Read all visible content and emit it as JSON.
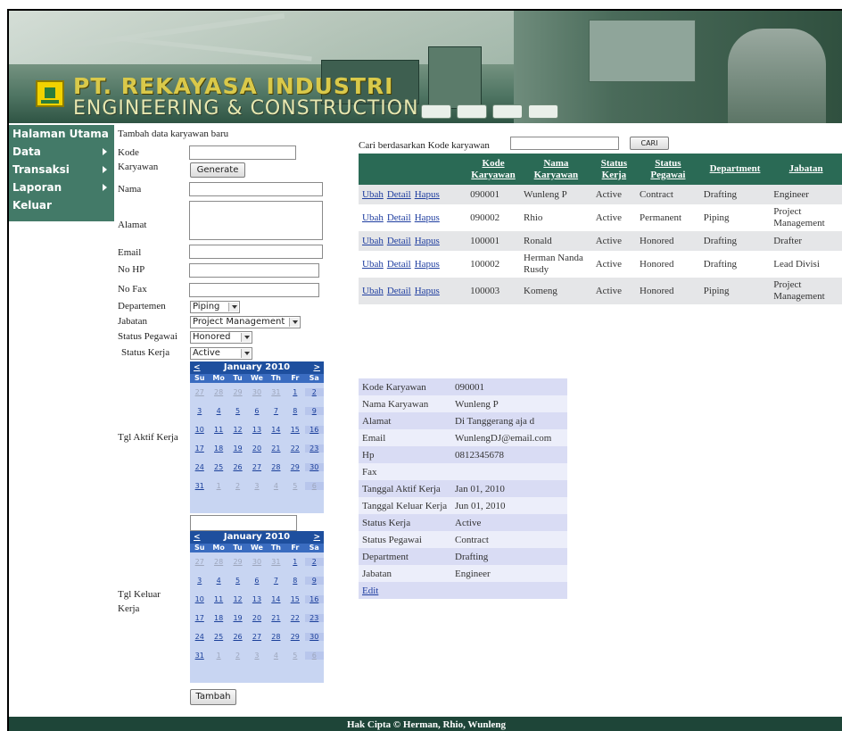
{
  "header": {
    "title_line1": "PT. REKAYASA INDUSTRI",
    "title_line2": "ENGINEERING & CONSTRUCTION"
  },
  "sidebar": {
    "items": [
      {
        "label": "Halaman Utama",
        "has_submenu": false
      },
      {
        "label": "Data",
        "has_submenu": true
      },
      {
        "label": "Transaksi",
        "has_submenu": true
      },
      {
        "label": "Laporan",
        "has_submenu": true
      },
      {
        "label": "Keluar",
        "has_submenu": false
      }
    ]
  },
  "form": {
    "heading": "Tambah data karyawan baru",
    "labels": {
      "kode": "Kode",
      "karyawan": "Karyawan",
      "nama": "Nama",
      "alamat": "Alamat",
      "email": "Email",
      "no_hp": "No HP",
      "no_fax": "No Fax",
      "departemen": "Departemen",
      "jabatan": "Jabatan",
      "status_pegawai": "Status Pegawai",
      "status_kerja": "Status Kerja",
      "tgl_aktif": "Tgl Aktif Kerja",
      "tgl_keluar_1": "Tgl Keluar",
      "tgl_keluar_2": "Kerja"
    },
    "generate_label": "Generate",
    "departemen_value": "Piping",
    "jabatan_value": "Project Management",
    "status_pegawai_value": "Honored",
    "status_kerja_value": "Active",
    "submit_label": "Tambah"
  },
  "calendar": {
    "month": "January 2010",
    "prev": "<",
    "next": ">",
    "dows": [
      "Su",
      "Mo",
      "Tu",
      "We",
      "Th",
      "Fr",
      "Sa"
    ],
    "weeks": [
      [
        "27",
        "28",
        "29",
        "30",
        "31",
        "1",
        "2"
      ],
      [
        "3",
        "4",
        "5",
        "6",
        "7",
        "8",
        "9"
      ],
      [
        "10",
        "11",
        "12",
        "13",
        "14",
        "15",
        "16"
      ],
      [
        "17",
        "18",
        "19",
        "20",
        "21",
        "22",
        "23"
      ],
      [
        "24",
        "25",
        "26",
        "27",
        "28",
        "29",
        "30"
      ],
      [
        "31",
        "1",
        "2",
        "3",
        "4",
        "5",
        "6"
      ]
    ]
  },
  "search": {
    "label": "Cari berdasarkan Kode karyawan",
    "button": "CARI"
  },
  "table": {
    "headers": [
      "Kode Karyawan",
      "Nama Karyawan",
      "Status Kerja",
      "Status Pegawai",
      "Department",
      "Jabatan"
    ],
    "action_labels": {
      "edit": "Ubah",
      "detail": "Detail",
      "delete": "Hapus"
    },
    "rows": [
      {
        "kode": "090001",
        "nama": "Wunleng P",
        "status_kerja": "Active",
        "status_pegawai": "Contract",
        "department": "Drafting",
        "jabatan": "Engineer"
      },
      {
        "kode": "090002",
        "nama": "Rhio",
        "status_kerja": "Active",
        "status_pegawai": "Permanent",
        "department": "Piping",
        "jabatan": "Project Management"
      },
      {
        "kode": "100001",
        "nama": "Ronald",
        "status_kerja": "Active",
        "status_pegawai": "Honored",
        "department": "Drafting",
        "jabatan": "Drafter"
      },
      {
        "kode": "100002",
        "nama": "Herman Nanda Rusdy",
        "status_kerja": "Active",
        "status_pegawai": "Honored",
        "department": "Drafting",
        "jabatan": "Lead Divisi"
      },
      {
        "kode": "100003",
        "nama": "Komeng",
        "status_kerja": "Active",
        "status_pegawai": "Honored",
        "department": "Piping",
        "jabatan": "Project Management"
      }
    ]
  },
  "detail": {
    "rows": [
      {
        "label": "Kode Karyawan",
        "value": "090001"
      },
      {
        "label": "Nama Karyawan",
        "value": "Wunleng P"
      },
      {
        "label": "Alamat",
        "value": "Di Tanggerang aja d"
      },
      {
        "label": "Email",
        "value": "WunlengDJ@email.com"
      },
      {
        "label": "Hp",
        "value": "0812345678"
      },
      {
        "label": "Fax",
        "value": ""
      },
      {
        "label": "Tanggal Aktif Kerja",
        "value": "Jan 01, 2010"
      },
      {
        "label": "Tanggal Keluar Kerja",
        "value": "Jun 01, 2010"
      },
      {
        "label": "Status Kerja",
        "value": "Active"
      },
      {
        "label": "Status Pegawai",
        "value": "Contract"
      },
      {
        "label": "Department",
        "value": "Drafting"
      },
      {
        "label": "Jabatan",
        "value": "Engineer"
      }
    ],
    "edit_label": "Edit"
  },
  "footer": {
    "text": "Hak Cipta © Herman, Rhio, Wunleng"
  }
}
